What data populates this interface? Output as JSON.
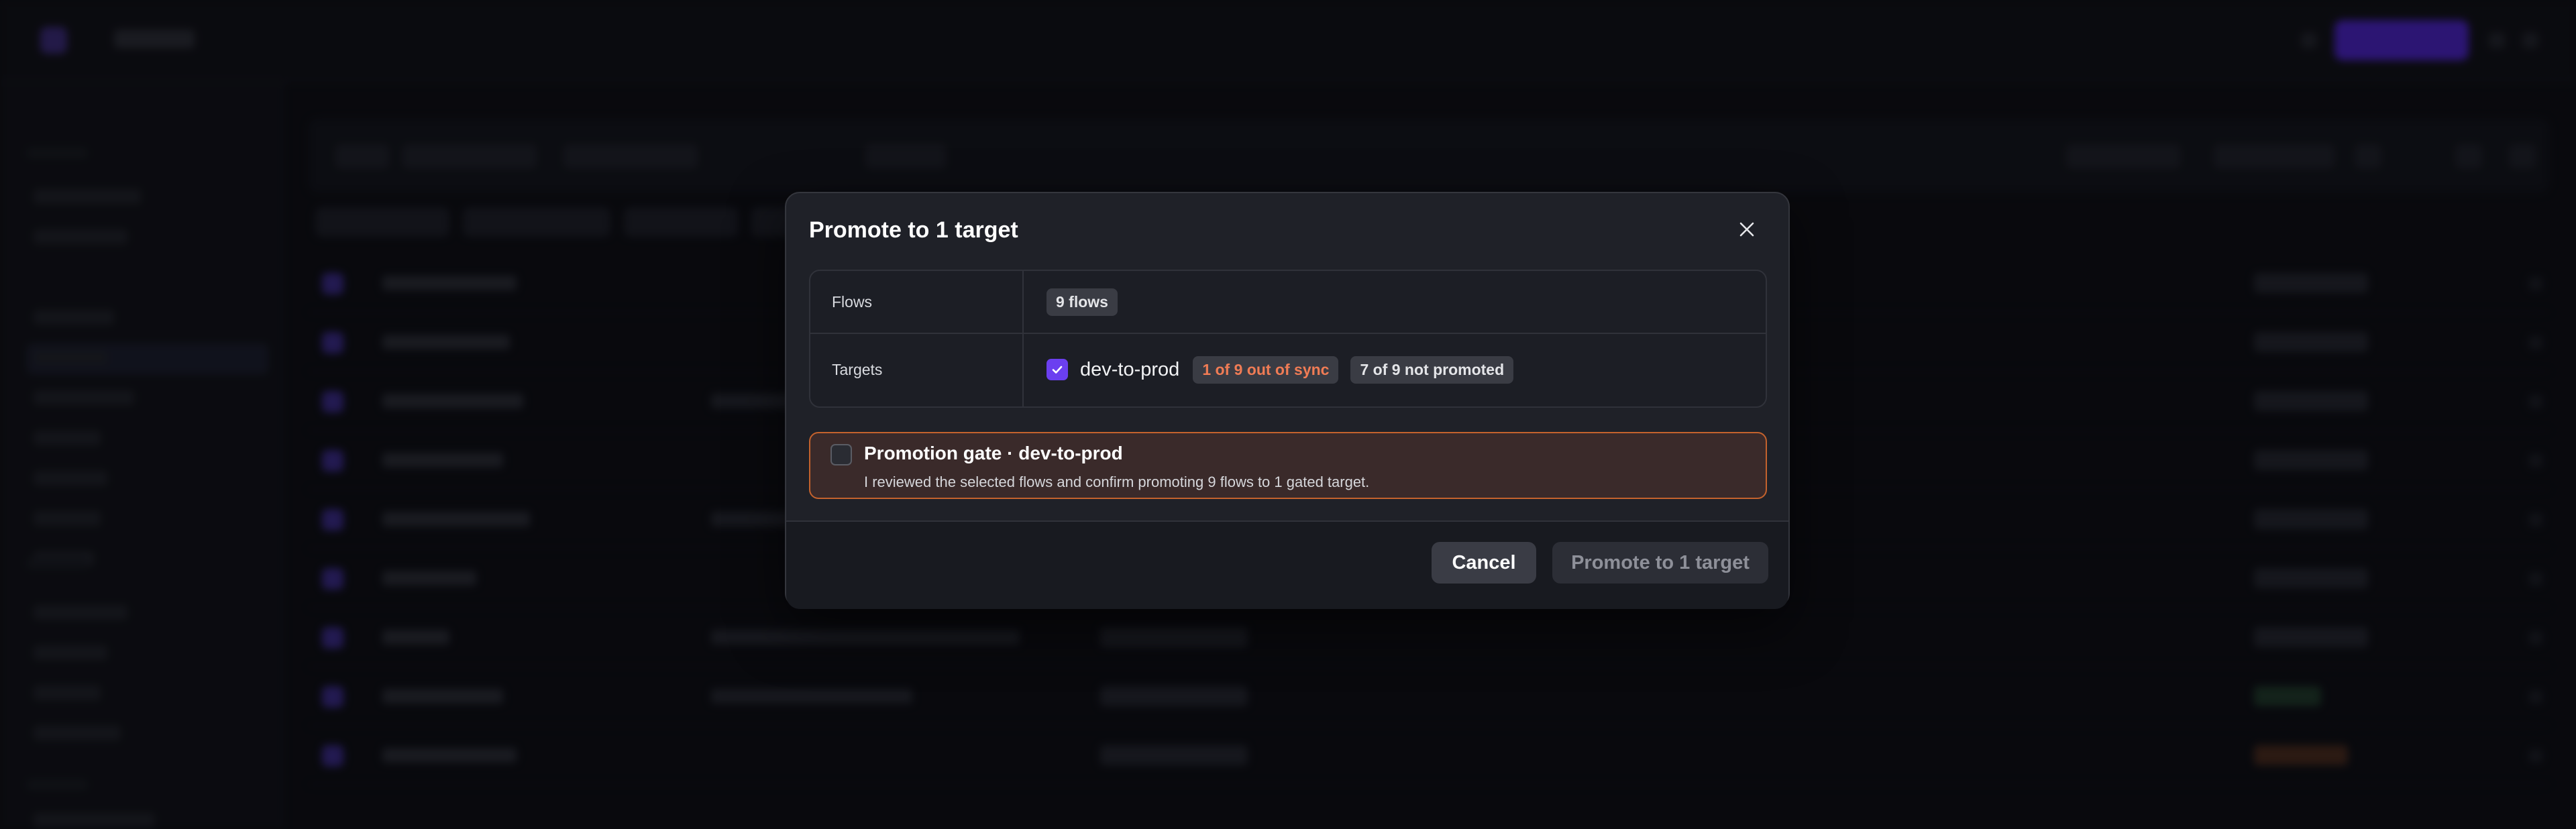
{
  "modal": {
    "title": "Promote to 1 target",
    "flows_label": "Flows",
    "flows_value": "9 flows",
    "targets_label": "Targets",
    "target": {
      "name": "dev-to-prod",
      "checked": true,
      "sync_badge": "1 of 9 out of sync",
      "promote_badge": "7 of 9 not promoted"
    },
    "gate": {
      "checked": false,
      "title": "Promotion gate · dev-to-prod",
      "description": "I reviewed the selected flows and confirm promoting 9 flows to 1 gated target."
    },
    "cancel_label": "Cancel",
    "promote_label": "Promote to 1 target",
    "promote_enabled": false
  },
  "icons": {
    "close": "close-icon",
    "checkmark": "check-icon"
  },
  "colors": {
    "accent": "#6b3ff0",
    "warning_text": "#f07c55",
    "gate_border": "#c4622d"
  }
}
